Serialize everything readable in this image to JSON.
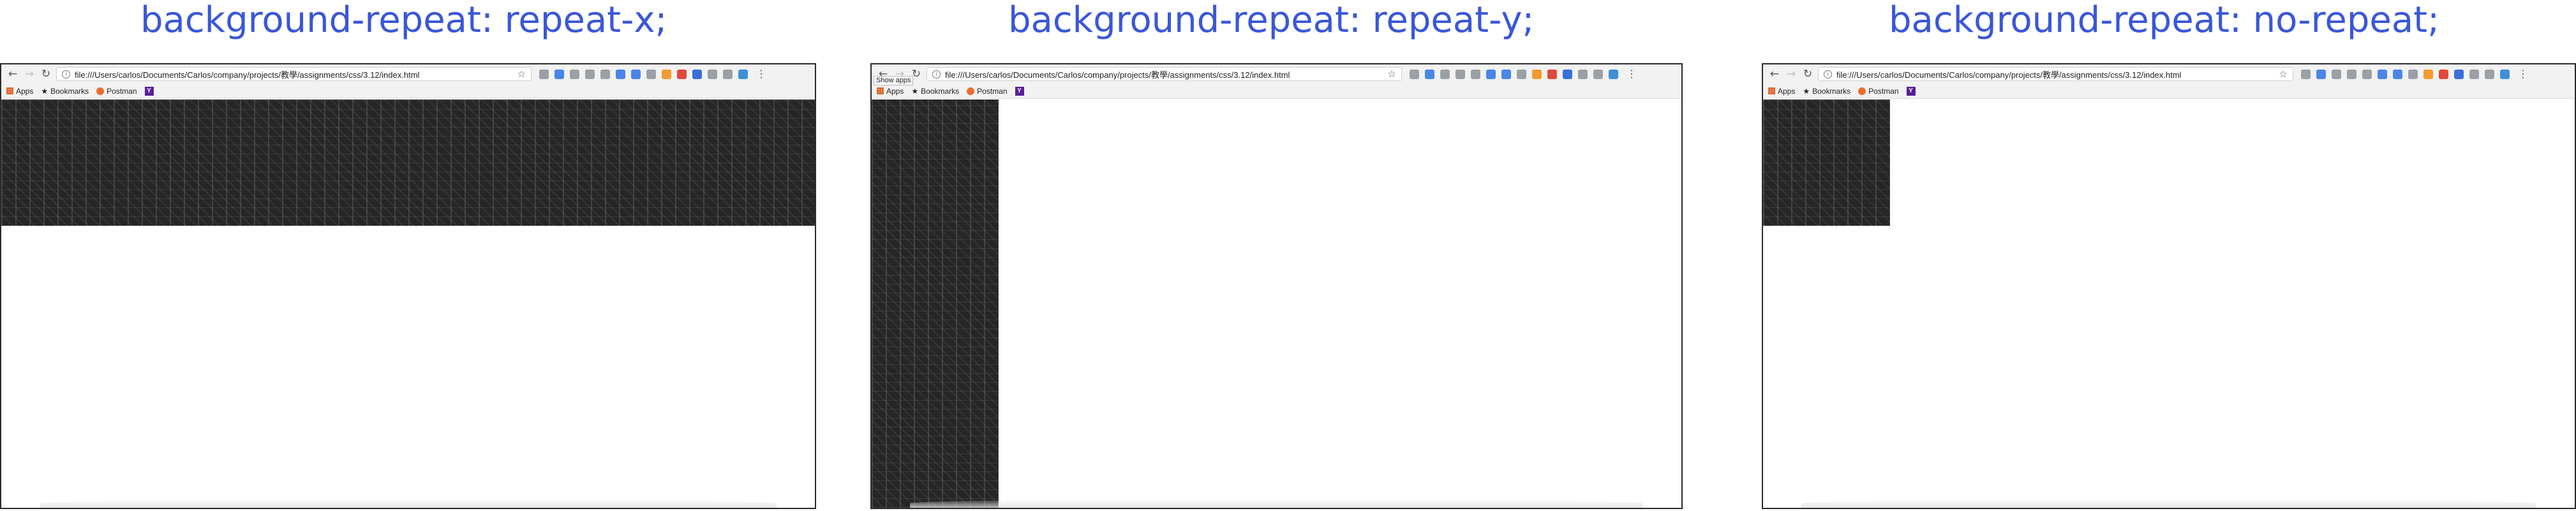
{
  "panels": [
    {
      "title": "background-repeat: repeat-x;",
      "browser": {
        "url": "file:///Users/carlos/Documents/Carlos/company/projects/教學/assignments/css/3.12/index.html",
        "bookmarks": [
          "Apps",
          "Bookmarks",
          "Postman"
        ],
        "bookmark_y_label": "Y",
        "tooltip": ""
      },
      "background_repeat": "repeat-x"
    },
    {
      "title": "background-repeat: repeat-y;",
      "browser": {
        "url": "file:///Users/carlos/Documents/Carlos/company/projects/教學/assignments/css/3.12/index.html",
        "bookmarks": [
          "Apps",
          "Bookmarks",
          "Postman"
        ],
        "bookmark_y_label": "Y",
        "tooltip": "Show apps"
      },
      "background_repeat": "repeat-y"
    },
    {
      "title": "background-repeat: no-repeat;",
      "browser": {
        "url": "file:///Users/carlos/Documents/Carlos/company/projects/教學/assignments/css/3.12/index.html",
        "bookmarks": [
          "Apps",
          "Bookmarks",
          "Postman"
        ],
        "bookmark_y_label": "Y",
        "tooltip": ""
      },
      "background_repeat": "no-repeat"
    }
  ],
  "icons": {
    "back": "back-arrow-icon",
    "forward": "forward-arrow-icon",
    "reload": "reload-icon",
    "info": "info-icon",
    "star": "bookmark-star-icon",
    "menu": "menu-dots-icon"
  },
  "colors": {
    "title": "#3a57d8",
    "pattern": "#262626",
    "extensions": [
      "#9aa0a6",
      "#4a86e8",
      "#9aa0a6",
      "#9aa0a6",
      "#9aa0a6",
      "#4a86e8",
      "#4a86e8",
      "#9aa0a6",
      "#f29b30",
      "#e04a3a",
      "#3a6fd8",
      "#9aa0a6",
      "#9aa0a6",
      "#3f8fd8"
    ]
  }
}
